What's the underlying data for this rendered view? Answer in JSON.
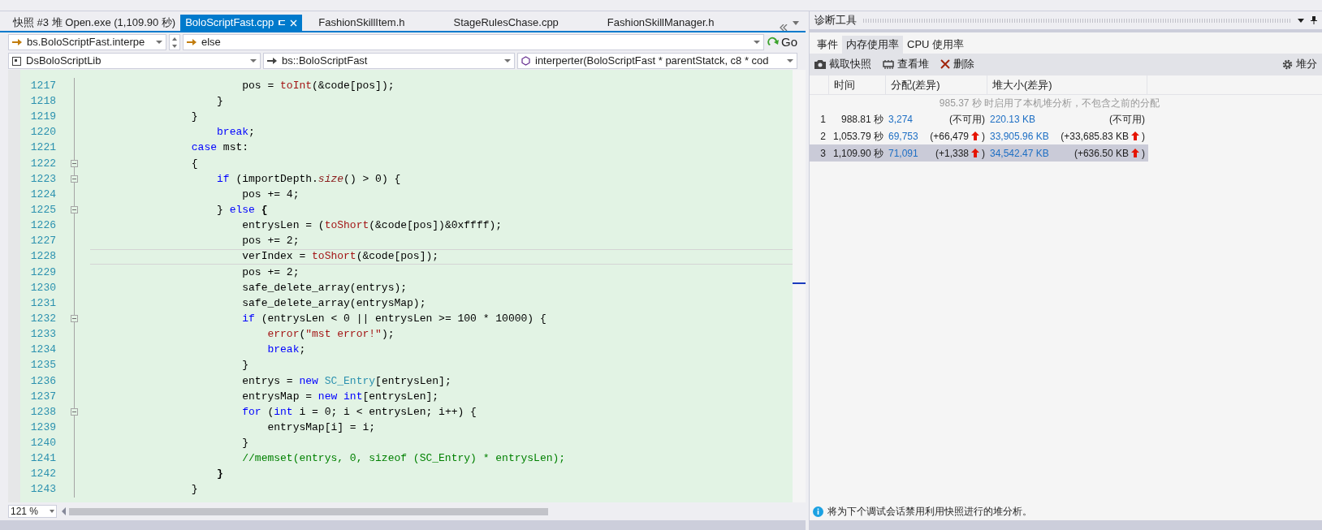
{
  "doc_tabs": [
    {
      "label": "快照 #3 堆 Open.exe (1,109.90 秒)",
      "selected": false,
      "pinned": false
    },
    {
      "label": "BoloScriptFast.cpp",
      "selected": true,
      "pinned": true
    },
    {
      "label": "FashionSkillItem.h",
      "selected": false,
      "pinned": false
    },
    {
      "label": "StageRulesChase.cpp",
      "selected": false,
      "pinned": false
    },
    {
      "label": "FashionSkillManager.h",
      "selected": false,
      "pinned": false
    }
  ],
  "nav_bar": {
    "scope": "bs.BoloScriptFast.interpe",
    "block": "else",
    "go": "Go",
    "project": "DsBoloScriptLib",
    "type": "bs::BoloScriptFast",
    "member": "interperter(BoloScriptFast * parentStatck, c8 * cod"
  },
  "code_lines": [
    {
      "num": "1217",
      "fold": false,
      "current": false,
      "tokens": [
        {
          "kind": "p",
          "text": "                        pos = "
        },
        {
          "kind": "fn",
          "text": "toInt"
        },
        {
          "kind": "p",
          "text": "(&code[pos]);"
        }
      ]
    },
    {
      "num": "1218",
      "fold": false,
      "current": false,
      "tokens": [
        {
          "kind": "p",
          "text": "                    }"
        }
      ]
    },
    {
      "num": "1219",
      "fold": false,
      "current": false,
      "tokens": [
        {
          "kind": "p",
          "text": "                }"
        }
      ]
    },
    {
      "num": "1220",
      "fold": false,
      "current": false,
      "tokens": [
        {
          "kind": "kw",
          "text": "                    break"
        },
        {
          "kind": "p",
          "text": ";"
        }
      ]
    },
    {
      "num": "1221",
      "fold": false,
      "current": false,
      "tokens": [
        {
          "kind": "kw",
          "text": "                case"
        },
        {
          "kind": "p",
          "text": " mst:"
        }
      ]
    },
    {
      "num": "1222",
      "fold": true,
      "current": false,
      "tokens": [
        {
          "kind": "p",
          "text": "                {"
        }
      ]
    },
    {
      "num": "1223",
      "fold": true,
      "current": false,
      "tokens": [
        {
          "kind": "kw",
          "text": "                    if"
        },
        {
          "kind": "p",
          "text": " (importDepth."
        },
        {
          "kind": "it",
          "text": "size"
        },
        {
          "kind": "p",
          "text": "() > 0) {"
        }
      ]
    },
    {
      "num": "1224",
      "fold": false,
      "current": false,
      "tokens": [
        {
          "kind": "p",
          "text": "                        pos += 4;"
        }
      ]
    },
    {
      "num": "1225",
      "fold": true,
      "current": false,
      "tokens": [
        {
          "kind": "p",
          "text": "                    } "
        },
        {
          "kind": "kw",
          "text": "else"
        },
        {
          "kind": "b",
          "text": " {"
        }
      ]
    },
    {
      "num": "1226",
      "fold": false,
      "current": false,
      "tokens": [
        {
          "kind": "p",
          "text": "                        entrysLen = ("
        },
        {
          "kind": "fn",
          "text": "toShort"
        },
        {
          "kind": "p",
          "text": "(&code[pos])&0xffff);"
        }
      ]
    },
    {
      "num": "1227",
      "fold": false,
      "current": false,
      "tokens": [
        {
          "kind": "p",
          "text": "                        pos += 2;"
        }
      ]
    },
    {
      "num": "1228",
      "fold": false,
      "current": true,
      "tokens": [
        {
          "kind": "p",
          "text": "                        verIndex = "
        },
        {
          "kind": "fn",
          "text": "toShort"
        },
        {
          "kind": "p",
          "text": "(&code[pos]);"
        }
      ]
    },
    {
      "num": "1229",
      "fold": false,
      "current": false,
      "tokens": [
        {
          "kind": "p",
          "text": "                        pos += 2;"
        }
      ]
    },
    {
      "num": "1230",
      "fold": false,
      "current": false,
      "tokens": [
        {
          "kind": "p",
          "text": "                        safe_delete_array(entrys);"
        }
      ]
    },
    {
      "num": "1231",
      "fold": false,
      "current": false,
      "tokens": [
        {
          "kind": "p",
          "text": "                        safe_delete_array(entrysMap);"
        }
      ]
    },
    {
      "num": "1232",
      "fold": true,
      "current": false,
      "tokens": [
        {
          "kind": "kw",
          "text": "                        if"
        },
        {
          "kind": "p",
          "text": " (entrysLen < 0 || entrysLen >= 100 * 10000) {"
        }
      ]
    },
    {
      "num": "1233",
      "fold": false,
      "current": false,
      "tokens": [
        {
          "kind": "fn",
          "text": "                            error"
        },
        {
          "kind": "p",
          "text": "("
        },
        {
          "kind": "str",
          "text": "\"mst error!\""
        },
        {
          "kind": "p",
          "text": ");"
        }
      ]
    },
    {
      "num": "1234",
      "fold": false,
      "current": false,
      "tokens": [
        {
          "kind": "kw",
          "text": "                            break"
        },
        {
          "kind": "p",
          "text": ";"
        }
      ]
    },
    {
      "num": "1235",
      "fold": false,
      "current": false,
      "tokens": [
        {
          "kind": "p",
          "text": "                        }"
        }
      ]
    },
    {
      "num": "1236",
      "fold": false,
      "current": false,
      "tokens": [
        {
          "kind": "p",
          "text": "                        entrys = "
        },
        {
          "kind": "kw",
          "text": "new"
        },
        {
          "kind": "ty",
          "text": " SC_Entry"
        },
        {
          "kind": "p",
          "text": "[entrysLen];"
        }
      ]
    },
    {
      "num": "1237",
      "fold": false,
      "current": false,
      "tokens": [
        {
          "kind": "p",
          "text": "                        entrysMap = "
        },
        {
          "kind": "kw",
          "text": "new int"
        },
        {
          "kind": "p",
          "text": "[entrysLen];"
        }
      ]
    },
    {
      "num": "1238",
      "fold": true,
      "current": false,
      "tokens": [
        {
          "kind": "kw",
          "text": "                        for"
        },
        {
          "kind": "p",
          "text": " ("
        },
        {
          "kind": "kw",
          "text": "int"
        },
        {
          "kind": "p",
          "text": " i = 0; i < entrysLen; i++) {"
        }
      ]
    },
    {
      "num": "1239",
      "fold": false,
      "current": false,
      "tokens": [
        {
          "kind": "p",
          "text": "                            entrysMap[i] = i;"
        }
      ]
    },
    {
      "num": "1240",
      "fold": false,
      "current": false,
      "tokens": [
        {
          "kind": "p",
          "text": "                        }"
        }
      ]
    },
    {
      "num": "1241",
      "fold": false,
      "current": false,
      "tokens": [
        {
          "kind": "cm",
          "text": "                        //memset(entrys, 0, sizeof (SC_Entry) * entrysLen);"
        }
      ]
    },
    {
      "num": "1242",
      "fold": false,
      "current": false,
      "tokens": [
        {
          "kind": "b",
          "text": "                    }"
        }
      ]
    },
    {
      "num": "1243",
      "fold": false,
      "current": false,
      "tokens": [
        {
          "kind": "p",
          "text": "                }"
        }
      ]
    }
  ],
  "zoom": "121 %",
  "diagnostics": {
    "title": "诊断工具",
    "tabs": [
      {
        "label": "事件",
        "selected": false
      },
      {
        "label": "内存使用率",
        "selected": true
      },
      {
        "label": "CPU 使用率",
        "selected": false
      }
    ],
    "toolbar": [
      {
        "kind": "camera",
        "label": "截取快照"
      },
      {
        "kind": "heap",
        "label": "查看堆"
      },
      {
        "kind": "delete",
        "label": "删除"
      }
    ],
    "settings_label": "堆分",
    "columns": [
      "时间",
      "分配(差异)",
      "堆大小(差异)"
    ],
    "notice": "985.37 秒 时启用了本机堆分析，不包含之前的分配",
    "rows": [
      {
        "index": "1",
        "time": "988.81 秒",
        "alloc": "3,274",
        "alloc_diff": "(不可用)",
        "alloc_up": false,
        "alloc_end": "",
        "heap": "220.13 KB",
        "heap_diff": "(不可用)",
        "heap_up": false,
        "heap_end": "",
        "selected": false
      },
      {
        "index": "2",
        "time": "1,053.79 秒",
        "alloc": "69,753",
        "alloc_diff": "(+66,479",
        "alloc_up": true,
        "alloc_end": ")",
        "heap": "33,905.96 KB",
        "heap_diff": "(+33,685.83 KB",
        "heap_up": true,
        "heap_end": ")",
        "selected": false
      },
      {
        "index": "3",
        "time": "1,109.90 秒",
        "alloc": "71,091",
        "alloc_diff": "(+1,338",
        "alloc_up": true,
        "alloc_end": ")",
        "heap": "34,542.47 KB",
        "heap_diff": "(+636.50 KB",
        "heap_up": true,
        "heap_end": ")",
        "selected": true
      }
    ],
    "info": "将为下个调试会话禁用利用快照进行的堆分析。"
  }
}
